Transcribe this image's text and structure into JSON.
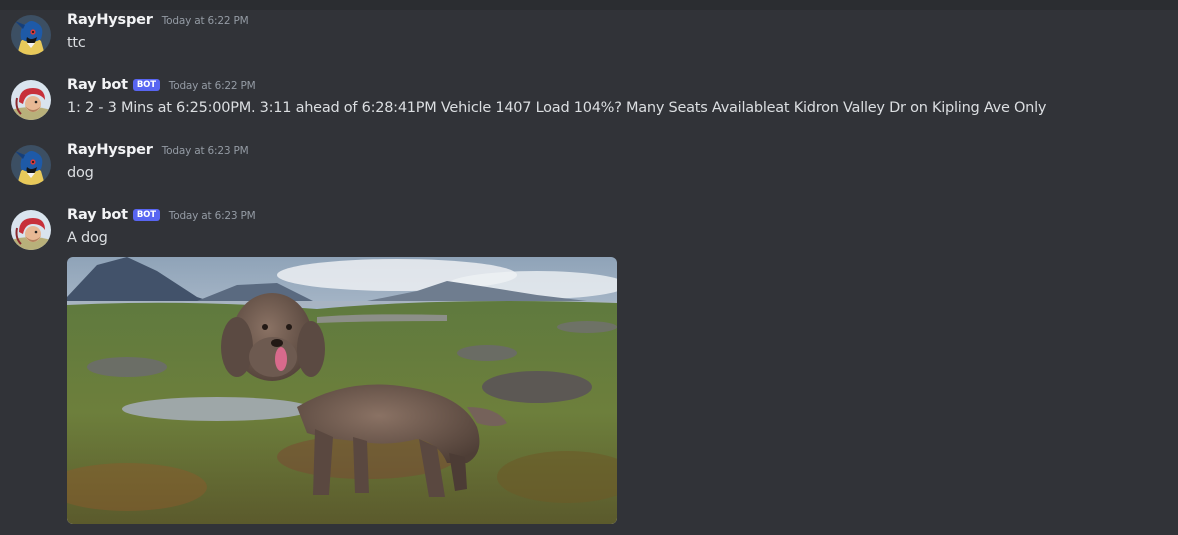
{
  "messages": [
    {
      "author": "RayHysper",
      "is_bot": false,
      "timestamp": "Today at 6:22 PM",
      "text": "ttc",
      "avatar_icon": "lucario-avatar-icon"
    },
    {
      "author": "Ray bot",
      "is_bot": true,
      "badge": "BOT",
      "timestamp": "Today at 6:22 PM",
      "text": "1: 2 - 3 Mins at 6:25:00PM. 3:11 ahead of 6:28:41PM Vehicle 1407 Load 104%? Many Seats Availableat Kidron Valley Dr on Kipling Ave Only",
      "avatar_icon": "character-avatar-icon"
    },
    {
      "author": "RayHysper",
      "is_bot": false,
      "timestamp": "Today at 6:23 PM",
      "text": "dog",
      "avatar_icon": "lucario-avatar-icon"
    },
    {
      "author": "Ray bot",
      "is_bot": true,
      "badge": "BOT",
      "timestamp": "Today at 6:23 PM",
      "text": "A dog",
      "avatar_icon": "character-avatar-icon",
      "attachment": "dog-photo"
    }
  ],
  "colors": {
    "background": "#313338",
    "username": "#f2f3f5",
    "text": "#dbdee1",
    "timestamp": "#949ba4",
    "bot_badge": "#5865f2"
  }
}
